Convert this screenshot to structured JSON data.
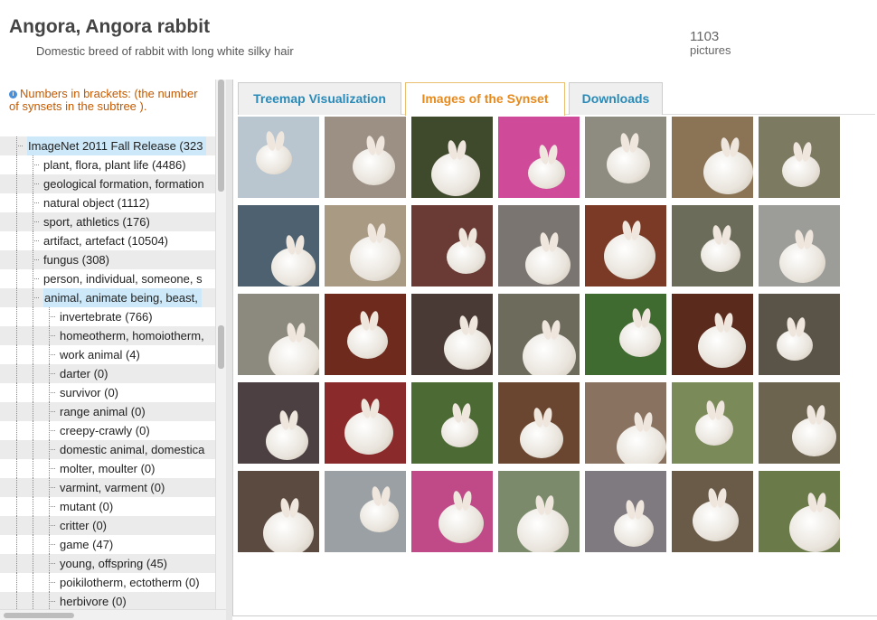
{
  "header": {
    "title": "Angora, Angora rabbit",
    "subtitle": "Domestic breed of rabbit with long white silky hair",
    "picture_count": "1103",
    "picture_label": "pictures"
  },
  "tree_note": "Numbers in brackets: (the number of synsets in the subtree ).",
  "tree": [
    {
      "label": "ImageNet 2011 Fall Release (323",
      "indent": 0,
      "selected": true
    },
    {
      "label": "plant, flora, plant life (4486)",
      "indent": 1
    },
    {
      "label": "geological formation, formation",
      "indent": 1
    },
    {
      "label": "natural object (1112)",
      "indent": 1
    },
    {
      "label": "sport, athletics (176)",
      "indent": 1
    },
    {
      "label": "artifact, artefact (10504)",
      "indent": 1
    },
    {
      "label": "fungus (308)",
      "indent": 1
    },
    {
      "label": "person, individual, someone, s",
      "indent": 1
    },
    {
      "label": "animal, animate being, beast, ",
      "indent": 1,
      "selected": true
    },
    {
      "label": "invertebrate (766)",
      "indent": 2
    },
    {
      "label": "homeotherm, homoiotherm,",
      "indent": 2
    },
    {
      "label": "work animal (4)",
      "indent": 2
    },
    {
      "label": "darter (0)",
      "indent": 2
    },
    {
      "label": "survivor (0)",
      "indent": 2
    },
    {
      "label": "range animal (0)",
      "indent": 2
    },
    {
      "label": "creepy-crawly (0)",
      "indent": 2
    },
    {
      "label": "domestic animal, domestica",
      "indent": 2
    },
    {
      "label": "molter, moulter (0)",
      "indent": 2
    },
    {
      "label": "varmint, varment (0)",
      "indent": 2
    },
    {
      "label": "mutant (0)",
      "indent": 2
    },
    {
      "label": "critter (0)",
      "indent": 2
    },
    {
      "label": "game (47)",
      "indent": 2
    },
    {
      "label": "young, offspring (45)",
      "indent": 2
    },
    {
      "label": "poikilotherm, ectotherm (0)",
      "indent": 2
    },
    {
      "label": "herbivore (0)",
      "indent": 2
    }
  ],
  "tabs": [
    {
      "label": "Treemap Visualization",
      "active": false
    },
    {
      "label": "Images of the Synset",
      "active": true
    },
    {
      "label": "Downloads",
      "active": false
    }
  ],
  "images": [
    {
      "bg": "#b9c6cf"
    },
    {
      "bg": "#9c8f83"
    },
    {
      "bg": "#3f4a2c"
    },
    {
      "bg": "#d04a9a"
    },
    {
      "bg": "#8e8c80"
    },
    {
      "bg": "#8a7455"
    },
    {
      "bg": "#7d7a62"
    },
    {
      "bg": "#4d6170"
    },
    {
      "bg": "#a99a84"
    },
    {
      "bg": "#6a3a34"
    },
    {
      "bg": "#7a7570"
    },
    {
      "bg": "#7a3a26"
    },
    {
      "bg": "#6b6d5a"
    },
    {
      "bg": "#9c9c98"
    },
    {
      "bg": "#8c8a7e"
    },
    {
      "bg": "#6e2a1c"
    },
    {
      "bg": "#4a3a36"
    },
    {
      "bg": "#6d6b5c"
    },
    {
      "bg": "#3f6a30"
    },
    {
      "bg": "#5a2a1c"
    },
    {
      "bg": "#5a5448"
    },
    {
      "bg": "#4c4042"
    },
    {
      "bg": "#8a2a2a"
    },
    {
      "bg": "#4c6a34"
    },
    {
      "bg": "#6a4630"
    },
    {
      "bg": "#8a7260"
    },
    {
      "bg": "#7a8a58"
    },
    {
      "bg": "#6d6450"
    },
    {
      "bg": "#5a4a40"
    },
    {
      "bg": "#9aa0a4"
    },
    {
      "bg": "#c04a88"
    },
    {
      "bg": "#7a8a6a"
    },
    {
      "bg": "#7f7a80"
    },
    {
      "bg": "#6a5a48"
    },
    {
      "bg": "#6a7a48"
    }
  ]
}
